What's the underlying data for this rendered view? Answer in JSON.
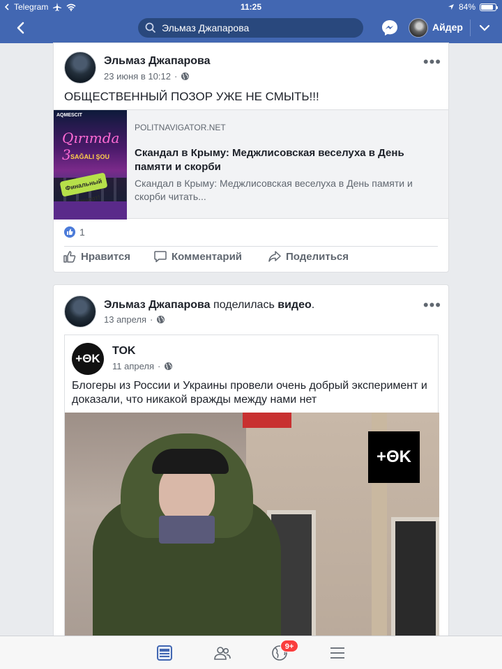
{
  "status_bar": {
    "app": "Telegram",
    "time": "11:25",
    "battery": "84%",
    "battery_level": 0.84
  },
  "header": {
    "search_query": "Эльмаз Джапарова",
    "user_name": "Айдер"
  },
  "post1": {
    "author": "Эльмаз Джапарова",
    "date": "23 июня в 10:12",
    "text": "ОБЩЕСТВЕННЫЙ ПОЗОР УЖЕ НЕ СМЫТЬ!!!",
    "link": {
      "domain": "POLITNAVIGATOR.NET",
      "title": "Скандал в Крыму: Меджлисовская веселуха в День памяти и скорби",
      "description": "Скандал в Крыму: Меджлисовская веселуха в День памяти и скорби читать...",
      "thumb_text": {
        "top": "AQMESCIT",
        "script": "Qırımda 3",
        "sub": "SAĞALI ŞOU",
        "sticker": "Финальный концерт!"
      }
    },
    "likes": "1",
    "actions": {
      "like": "Нравится",
      "comment": "Комментарий",
      "share": "Поделиться"
    }
  },
  "post2": {
    "author": "Эльмаз Джапарова",
    "shared_verb": "поделилась",
    "shared_object": "видео",
    "date": "13 апреля",
    "shared": {
      "page_name": "TOK",
      "date": "11 апреля",
      "text": "Блогеры из России и Украины провели очень добрый эксперимент и доказали, что никакой вражды между нами нет",
      "logo_text": "+ΘK"
    }
  },
  "tabbar": {
    "notifications_badge": "9+"
  },
  "colors": {
    "brand_blue": "#4267b2",
    "search_bg": "#29487d",
    "badge_red": "#fa3e3e",
    "like_blue": "#4c7bd9"
  },
  "icons": {
    "back": "chevron-left-icon",
    "search": "search-icon",
    "messenger": "messenger-icon",
    "dropdown": "chevron-down-icon",
    "globe": "globe-icon",
    "more": "more-horizontal-icon",
    "like": "thumbs-up-icon",
    "comment": "comment-icon",
    "share": "share-icon",
    "tab_feed": "news-feed-icon",
    "tab_friends": "friends-icon",
    "tab_notifications": "globe-notifications-icon",
    "tab_menu": "menu-icon"
  }
}
